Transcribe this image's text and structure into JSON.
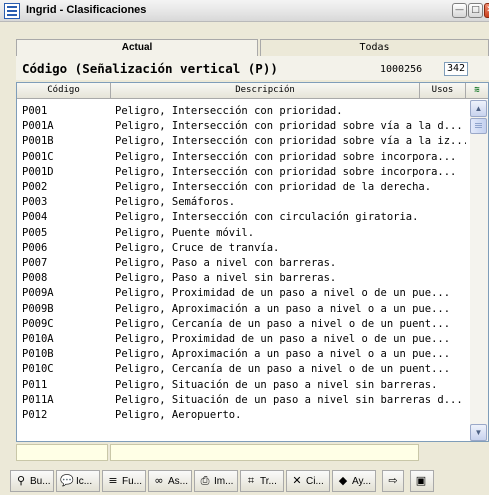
{
  "window": {
    "title": "Ingrid - Clasificaciones",
    "min_glyph": "—",
    "max_glyph": "□",
    "close_glyph": "✕"
  },
  "tabs": [
    {
      "label": "Actual",
      "selected": true
    },
    {
      "label": "Todas",
      "selected": false
    }
  ],
  "heading": {
    "title": "Código (Señalización vertical (P))",
    "count": "1000256",
    "box": "342"
  },
  "columns": {
    "codigo": "Código",
    "descripcion": "Descripción",
    "usos": "Usos",
    "icon": "≋"
  },
  "rows": [
    {
      "code": "P001",
      "desc": "Peligro, Intersección con prioridad."
    },
    {
      "code": "P001A",
      "desc": "Peligro, Intersección con prioridad sobre vía a la d..."
    },
    {
      "code": "P001B",
      "desc": "Peligro, Intersección con prioridad sobre vía a la iz..."
    },
    {
      "code": "P001C",
      "desc": "Peligro, Intersección con prioridad sobre incorpora..."
    },
    {
      "code": "P001D",
      "desc": "Peligro, Intersección con prioridad sobre incorpora..."
    },
    {
      "code": "P002",
      "desc": "Peligro, Intersección con prioridad de la derecha."
    },
    {
      "code": "P003",
      "desc": "Peligro, Semáforos."
    },
    {
      "code": "P004",
      "desc": "Peligro, Intersección con circulación giratoria."
    },
    {
      "code": "P005",
      "desc": "Peligro, Puente móvil."
    },
    {
      "code": "P006",
      "desc": "Peligro, Cruce de tranvía."
    },
    {
      "code": "P007",
      "desc": "Peligro, Paso a nivel con barreras."
    },
    {
      "code": "P008",
      "desc": "Peligro, Paso a nivel sin barreras."
    },
    {
      "code": "P009A",
      "desc": "Peligro, Proximidad de un paso a nivel o de un pue..."
    },
    {
      "code": "P009B",
      "desc": "Peligro, Aproximación a un paso a nivel o a un pue..."
    },
    {
      "code": "P009C",
      "desc": "Peligro, Cercanía de un paso a nivel o de un puent..."
    },
    {
      "code": "P010A",
      "desc": "Peligro, Proximidad de un paso a nivel o de un pue..."
    },
    {
      "code": "P010B",
      "desc": "Peligro, Aproximación a un paso a nivel o a un pue..."
    },
    {
      "code": "P010C",
      "desc": "Peligro, Cercanía de un paso a nivel o de un puent..."
    },
    {
      "code": "P011",
      "desc": "Peligro, Situación de un paso a nivel sin barreras."
    },
    {
      "code": "P011A",
      "desc": "Peligro, Situación de un paso a nivel sin barreras d..."
    },
    {
      "code": "P012",
      "desc": "Peligro, Aeropuerto."
    }
  ],
  "scrollbar": {
    "up": "▲",
    "down": "▼"
  },
  "taskbar": [
    {
      "icon": "binoculars-icon",
      "glyph": "⚲",
      "label": "Bu..."
    },
    {
      "icon": "speech-bubble-icon",
      "glyph": "💬",
      "label": "Ic..."
    },
    {
      "icon": "function-icon",
      "glyph": "≡",
      "label": "Fu..."
    },
    {
      "icon": "link-icon",
      "glyph": "∞",
      "label": "As..."
    },
    {
      "icon": "printer-icon",
      "glyph": "⎙",
      "label": "Im..."
    },
    {
      "icon": "tree-icon",
      "glyph": "⌗",
      "label": "Tr..."
    },
    {
      "icon": "close-x-icon",
      "glyph": "✕",
      "label": "Ci..."
    },
    {
      "icon": "help-icon",
      "glyph": "◆",
      "label": "Ay..."
    },
    {
      "icon": "export-icon",
      "glyph": "⇨",
      "label": ""
    },
    {
      "icon": "extra-icon",
      "glyph": "▣",
      "label": ""
    }
  ]
}
